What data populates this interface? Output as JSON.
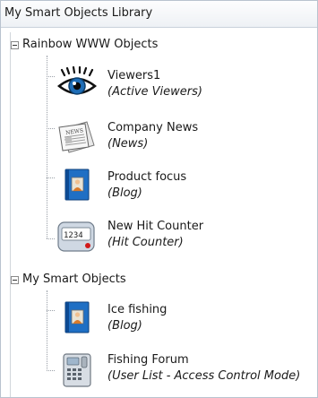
{
  "panel": {
    "title": "My Smart Objects Library"
  },
  "groups": [
    {
      "label": "Rainbow WWW Objects",
      "items": [
        {
          "name": "Viewers1",
          "type": "(Active Viewers)",
          "icon": "eye-icon"
        },
        {
          "name": "Company News",
          "type": "(News)",
          "icon": "newspaper-icon"
        },
        {
          "name": "Product focus",
          "type": "(Blog)",
          "icon": "blog-book-icon"
        },
        {
          "name": "New Hit Counter",
          "type": "(Hit Counter)",
          "icon": "hit-counter-icon",
          "counter_text": "1234"
        }
      ]
    },
    {
      "label": "My Smart Objects",
      "items": [
        {
          "name": "Ice fishing",
          "type": "(Blog)",
          "icon": "blog-book-icon"
        },
        {
          "name": "Fishing Forum",
          "type": "(User List - Access Control Mode)",
          "icon": "keypad-lock-icon"
        }
      ]
    }
  ],
  "colors": {
    "header_bg": "#eef1f5",
    "blog_blue": "#1f6fc4",
    "counter_bg": "#cfd8e3"
  }
}
